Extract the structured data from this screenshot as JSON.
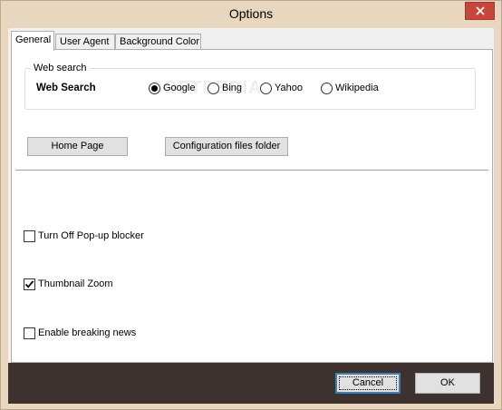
{
  "window": {
    "title": "Options"
  },
  "tabs": [
    {
      "label": "General",
      "active": true
    },
    {
      "label": "User Agent",
      "active": false
    },
    {
      "label": "Background Color",
      "active": false
    }
  ],
  "web_search_group": {
    "legend": "Web search",
    "label": "Web Search",
    "options": [
      {
        "label": "Google",
        "selected": true
      },
      {
        "label": "Bing",
        "selected": false
      },
      {
        "label": "Yahoo",
        "selected": false
      },
      {
        "label": "Wikipedia",
        "selected": false
      }
    ]
  },
  "buttons": {
    "home_page": "Home Page",
    "config_folder": "Configuration files folder",
    "cancel": "Cancel",
    "ok": "OK"
  },
  "checkboxes": [
    {
      "label": "Turn Off Pop-up blocker",
      "checked": false
    },
    {
      "label": "Thumbnail Zoom",
      "checked": true
    },
    {
      "label": "Enable breaking news",
      "checked": false
    }
  ],
  "watermark": "SOFTPEDIA",
  "colors": {
    "frame": "#e8d6bf",
    "close": "#c7463c",
    "bottom_bar": "#3e3230",
    "focus": "#3c7fb1"
  },
  "icons": {
    "close": "close-icon",
    "check": "checkmark-icon"
  }
}
